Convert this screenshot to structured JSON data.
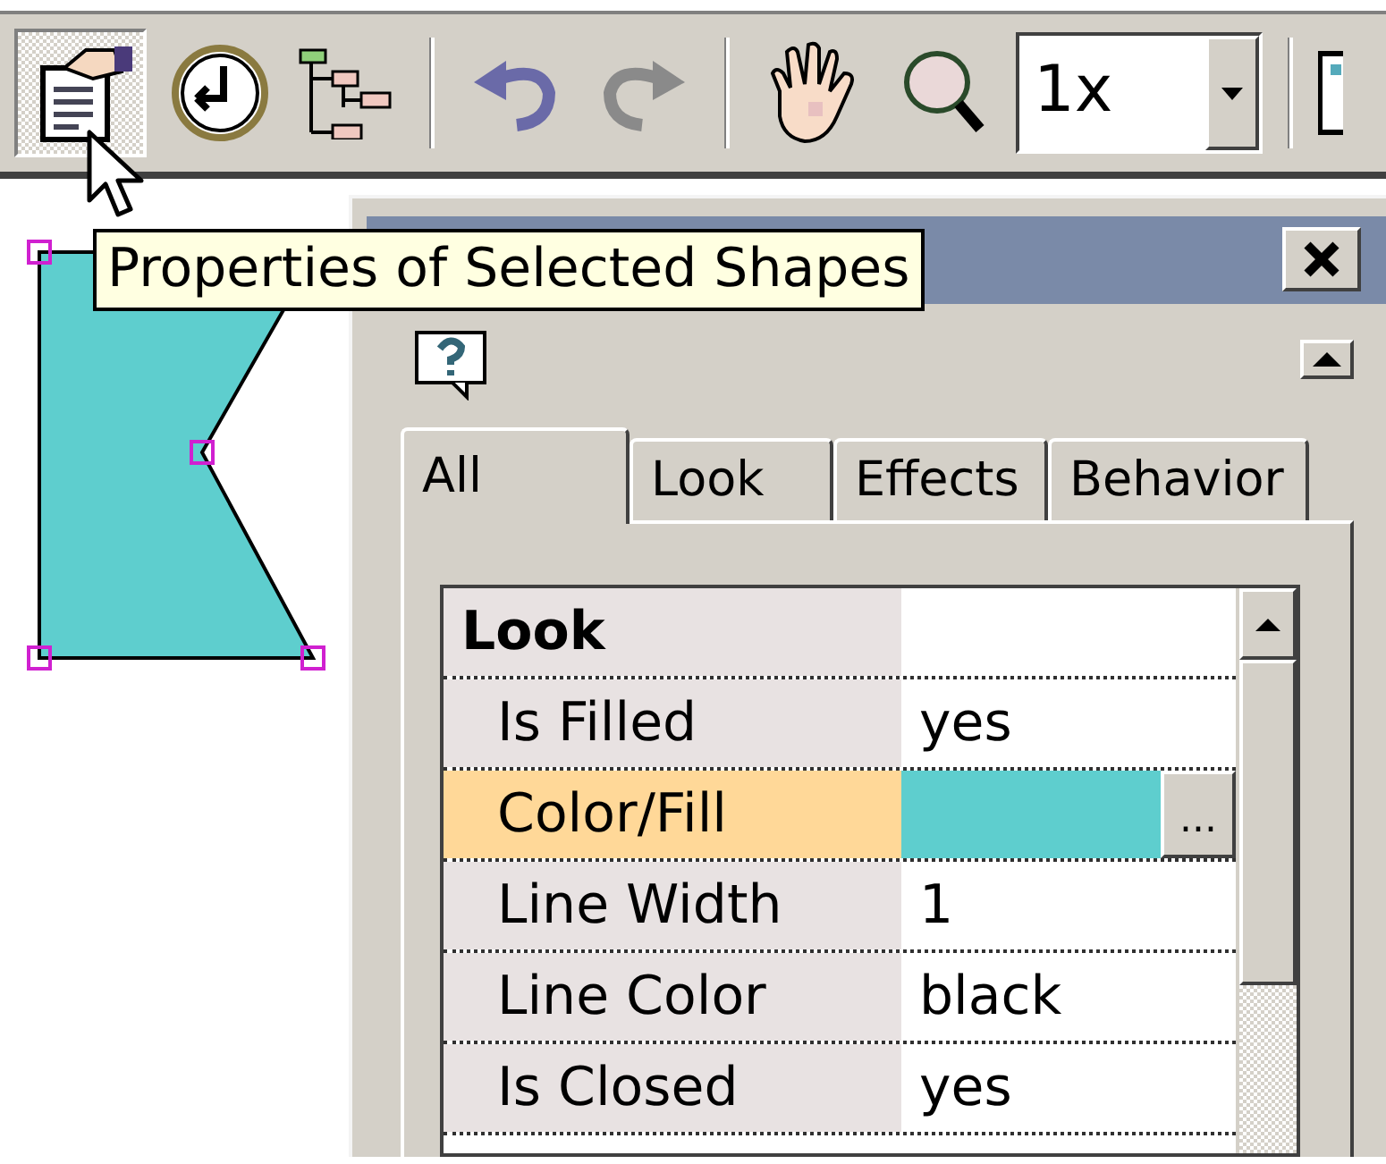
{
  "toolbar": {
    "buttons": [
      {
        "kind": "properties",
        "selected": true
      },
      {
        "kind": "clock",
        "selected": false
      },
      {
        "kind": "tree",
        "selected": false
      },
      {
        "kind": "separator"
      },
      {
        "kind": "undo",
        "selected": false
      },
      {
        "kind": "redo",
        "selected": false
      },
      {
        "kind": "separator"
      },
      {
        "kind": "hand",
        "selected": false
      },
      {
        "kind": "zoom",
        "selected": false
      }
    ],
    "zoom_combo": {
      "value": "1x"
    }
  },
  "tooltip": "Properties of Selected Shapes",
  "shape": {
    "color": "#5ecece"
  },
  "panel": {
    "tabs": [
      {
        "label": "All",
        "selected": true
      },
      {
        "label": "Look",
        "selected": false
      },
      {
        "label": "Effects",
        "selected": false
      },
      {
        "label": "Behavior",
        "selected": false
      }
    ],
    "rows": [
      {
        "kind": "header",
        "name": "Look",
        "selected": false
      },
      {
        "kind": "text",
        "name": "Is Filled",
        "value": "yes",
        "selected": false
      },
      {
        "kind": "color",
        "name": "Color/Fill",
        "color": "#5ecece",
        "button": "...",
        "selected": true
      },
      {
        "kind": "text",
        "name": "Line Width",
        "value": "1",
        "selected": false
      },
      {
        "kind": "text",
        "name": "Line Color",
        "value": "black",
        "selected": false
      },
      {
        "kind": "text",
        "name": "Is Closed",
        "value": "yes",
        "selected": false
      }
    ]
  }
}
